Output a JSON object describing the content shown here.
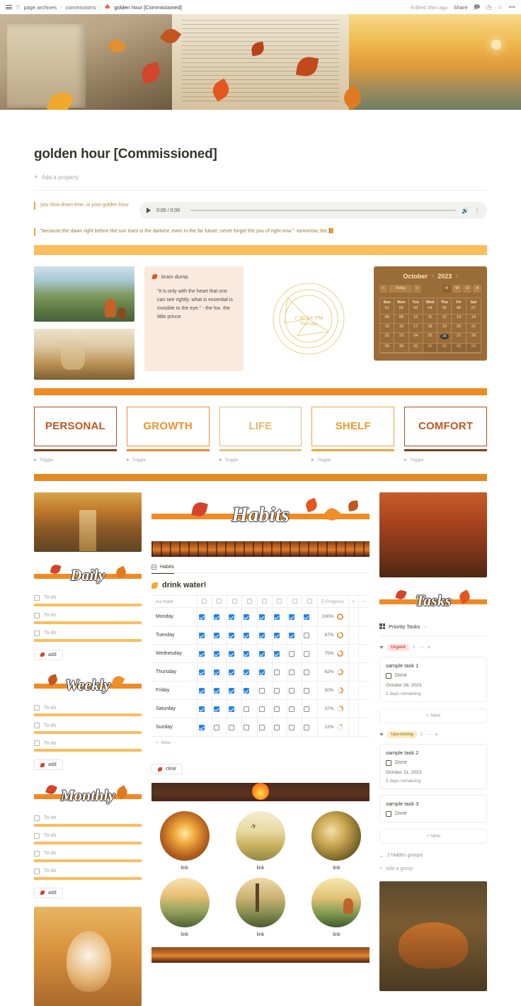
{
  "topbar": {
    "menu_icon": "hamburger-icon",
    "breadcrumbs": [
      {
        "label": "page archives",
        "icon": "archive-icon"
      },
      {
        "label": "commissions",
        "icon": ""
      },
      {
        "label": "golden hour [Commissioned]",
        "icon": "🍁"
      }
    ],
    "edited": "Edited 36m ago",
    "share": "Share",
    "icons": [
      "comment-icon",
      "clock-icon",
      "star-icon",
      "more-icon"
    ]
  },
  "page": {
    "title": "golden hour [Commissioned]",
    "add_property": "Add a property"
  },
  "audio": {
    "lyric": "you slow down time, in your golden hour",
    "time": "0:00 / 0:00",
    "play_icon": "play-icon",
    "volume_icon": "volume-icon",
    "more_icon": "more-icon"
  },
  "quote_banner": "\"because the dawn right before the sun rises is the darkest. even in the far future, never forget the you of right now.\" -tomorrow; bts 📙",
  "brain_dump": {
    "heading": "brain dump.",
    "icon": "leaf-icon",
    "quote": "\"it is only with the heart that one can see rightly. what is essential is invisible to the eye.\" - the fox. the little prince"
  },
  "clock": {
    "time": "7:30:54 PM",
    "day": "Thursday"
  },
  "calendar": {
    "month": "October",
    "year": "2023",
    "prev_icon": "‹",
    "next_icon": "›",
    "controls": {
      "prev": "<",
      "today": "Today",
      "next": ">"
    },
    "views": [
      "M",
      "W",
      "D",
      "A"
    ],
    "selected_view": "M",
    "weekdays": [
      "Sun",
      "Mon",
      "Tue",
      "Wed",
      "Thu",
      "Fri",
      "Sat"
    ],
    "weeks": [
      {
        "days": [
          "01",
          "02",
          "03",
          "04",
          "05",
          "06",
          "07"
        ],
        "dim": [
          false,
          false,
          false,
          false,
          false,
          false,
          false
        ]
      },
      {
        "days": [
          "08",
          "09",
          "10",
          "11",
          "12",
          "13",
          "14"
        ],
        "dim": [
          false,
          false,
          false,
          false,
          false,
          false,
          false
        ]
      },
      {
        "days": [
          "15",
          "16",
          "17",
          "18",
          "19",
          "20",
          "21"
        ],
        "dim": [
          false,
          false,
          false,
          false,
          false,
          false,
          false
        ]
      },
      {
        "days": [
          "22",
          "23",
          "24",
          "25",
          "26",
          "27",
          "28"
        ],
        "dim": [
          false,
          false,
          false,
          false,
          false,
          false,
          false
        ]
      },
      {
        "days": [
          "29",
          "30",
          "31",
          "01",
          "02",
          "03",
          "04"
        ],
        "dim": [
          false,
          false,
          false,
          true,
          true,
          true,
          true
        ]
      }
    ],
    "today": "26"
  },
  "categories": [
    {
      "label": "PERSONAL",
      "color": "#c1561f",
      "border": "#b04a1a",
      "underline": "#7d3f18",
      "toggle": "Toggle"
    },
    {
      "label": "GROWTH",
      "color": "#f0902a",
      "border": "#ef8f28",
      "underline": "#f08a24",
      "toggle": "Toggle"
    },
    {
      "label": "LIFE",
      "color": "#e2b96a",
      "border": "#ddbd86",
      "underline": "#e6c07c",
      "toggle": "Toggle"
    },
    {
      "label": "SHELF",
      "color": "#f09a2c",
      "border": "#f0a33c",
      "underline": "#f0a33c",
      "toggle": "Toggle"
    },
    {
      "label": "COMFORT",
      "color": "#c1561f",
      "border": "#b04a1a",
      "underline": "#7d3f18",
      "toggle": "Toggle"
    }
  ],
  "left_column": {
    "daily": {
      "banner": "Daily",
      "items": [
        "To-do",
        "To-do",
        "To-do"
      ],
      "add_label": "add"
    },
    "weekly": {
      "banner": "Weekly",
      "items": [
        "To-do",
        "To-do",
        "To-do"
      ],
      "add_label": "add"
    },
    "monthly": {
      "banner": "Monthly",
      "items": [
        "To-do",
        "To-do",
        "To-do",
        "To-do"
      ],
      "add_label": "add"
    }
  },
  "habits": {
    "banner": "Habits",
    "tab_label": "Habits",
    "tab_icon": "table-icon",
    "title": "drink water!",
    "title_icon": "leaf-icon",
    "col_name_header": "Habit",
    "col_name_prefix": "Aa",
    "checkbox_columns": 8,
    "progress_header": "Progress",
    "progress_sigma": "Σ",
    "add_column_icon": "+",
    "more_icon": "⋯",
    "new_row": "New",
    "clear_label": "clear",
    "rows": [
      {
        "day": "Monday",
        "checks": [
          true,
          true,
          true,
          true,
          true,
          true,
          true,
          true
        ],
        "progress": "100%",
        "pct": 100
      },
      {
        "day": "Tuesday",
        "checks": [
          true,
          true,
          true,
          true,
          true,
          true,
          true,
          false
        ],
        "progress": "87%",
        "pct": 87
      },
      {
        "day": "Wednesday",
        "checks": [
          true,
          true,
          true,
          true,
          true,
          true,
          false,
          false
        ],
        "progress": "75%",
        "pct": 75
      },
      {
        "day": "Thursday",
        "checks": [
          true,
          true,
          true,
          true,
          true,
          false,
          false,
          false
        ],
        "progress": "62%",
        "pct": 62
      },
      {
        "day": "Friday",
        "checks": [
          true,
          true,
          true,
          true,
          false,
          false,
          false,
          false
        ],
        "progress": "50%",
        "pct": 50
      },
      {
        "day": "Saturday",
        "checks": [
          true,
          true,
          true,
          false,
          false,
          false,
          false,
          false
        ],
        "progress": "37%",
        "pct": 37
      },
      {
        "day": "Sunday",
        "checks": [
          true,
          false,
          false,
          false,
          false,
          false,
          false,
          false
        ],
        "progress": "12%",
        "pct": 12
      }
    ]
  },
  "links": [
    {
      "label": "link",
      "art": "c1"
    },
    {
      "label": "link",
      "art": "c2"
    },
    {
      "label": "link",
      "art": "c3"
    },
    {
      "label": "link",
      "art": "c4"
    },
    {
      "label": "link",
      "art": "c5"
    },
    {
      "label": "link",
      "art": "c6"
    }
  ],
  "tasks": {
    "banner": "Tasks",
    "board_title": "Priority Tasks",
    "board_icon": "board-icon",
    "chevron": "⌄",
    "groups": [
      {
        "name": "Urgent",
        "style": "urgent",
        "count": "1",
        "dots": "⋯",
        "plus": "+",
        "cards": [
          {
            "title": "sample task 1",
            "done_label": "Done",
            "date": "October 28, 2023",
            "remaining": "2 days remaining"
          }
        ],
        "new_label": "New"
      },
      {
        "name": "Upcoming",
        "style": "upcoming",
        "count": "2",
        "dots": "⋯",
        "plus": "+",
        "cards": [
          {
            "title": "sample task 2",
            "done_label": "Done",
            "date": "October 31, 2023",
            "remaining": "5 days remaining"
          },
          {
            "title": "sample task 3",
            "done_label": "Done",
            "date": "",
            "remaining": ""
          }
        ],
        "new_label": "New"
      }
    ],
    "hidden_groups": "2 hidden groups",
    "add_group": "Add a group"
  },
  "colors": {
    "accent_orange": "#f08a24",
    "light_orange": "#fbbd5e",
    "brown": "#9a6c3a",
    "checkbox_blue": "#2383e2",
    "cream": "#faeade"
  }
}
